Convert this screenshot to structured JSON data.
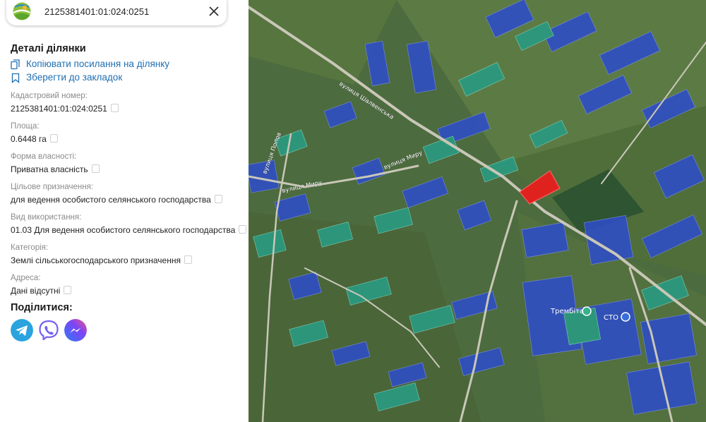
{
  "search": {
    "value": "2125381401:01:024:0251"
  },
  "panel": {
    "title": "Деталі ділянки",
    "copy_link": "Копіювати посилання на ділянку",
    "bookmark": "Зберегти до закладок",
    "fields": [
      {
        "label": "Кадастровий номер:",
        "value": "2125381401:01:024:0251"
      },
      {
        "label": "Площа:",
        "value": "0.6448 га"
      },
      {
        "label": "Форма власності:",
        "value": "Приватна власність"
      },
      {
        "label": "Цільове призначення:",
        "value": "для ведення особистого селянського господарства"
      },
      {
        "label": "Вид використання:",
        "value": "01.03 Для ведення особистого селянського господарства"
      },
      {
        "label": "Категорія:",
        "value": "Землі сільськогосподарського призначення"
      },
      {
        "label": "Адреса:",
        "value": "Дані відсутні"
      }
    ],
    "share_title": "Поділитися:"
  },
  "map": {
    "streets": [
      "вулиця Шалвенська",
      "вулиця Миру",
      "вулиця Миру",
      "вулиця Попов"
    ],
    "pois": [
      "Трембіта",
      "СТО"
    ]
  },
  "colors": {
    "link": "#1f6fb2",
    "telegram": "#2aa3df",
    "viber": "#7360f2",
    "messenger": "#5b5bf0",
    "selected_parcel": "#e0221f",
    "parcel_blue": "#2f4fc4",
    "parcel_teal": "#2a9b82"
  },
  "icons": [
    "app-logo-icon",
    "close-icon",
    "copy-link-icon",
    "bookmark-icon",
    "copy-icon",
    "telegram-icon",
    "viber-icon",
    "messenger-icon",
    "poi-marker-icon"
  ]
}
